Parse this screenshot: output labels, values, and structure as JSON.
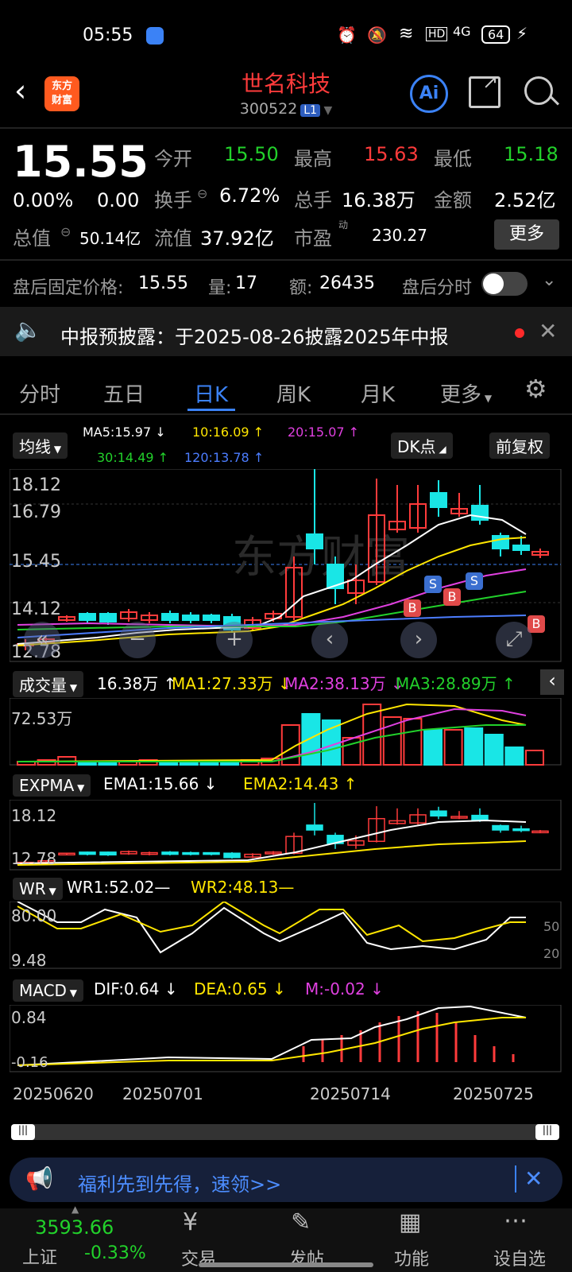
{
  "status": {
    "time": "05:55",
    "battery": "64",
    "net": "4G"
  },
  "header": {
    "name": "世名科技",
    "code": "300522",
    "level": "L1",
    "logo_top": "东方",
    "logo_bottom": "财富"
  },
  "quote": {
    "price": "15.55",
    "change_pct": "0.00%",
    "change": "0.00",
    "open_label": "今开",
    "open": "15.50",
    "high_label": "最高",
    "high": "15.63",
    "low_label": "最低",
    "low": "15.18",
    "turnover_label": "换手",
    "turnover": "6.72%",
    "volume_label": "总手",
    "volume": "16.38万",
    "amount_label": "金额",
    "amount": "2.52亿",
    "mktcap_label": "总值",
    "mktcap": "50.14亿",
    "float_label": "流值",
    "float": "37.92亿",
    "pe_label": "市盈",
    "pe_sup": "动",
    "pe": "230.27",
    "more": "更多"
  },
  "after_hours": {
    "label": "盘后固定价格:",
    "price": "15.55",
    "vol_label": "量:",
    "vol": "17",
    "amt_label": "额:",
    "amt": "26435",
    "timeshare": "盘后分时"
  },
  "notice": {
    "text": "中报预披露：于2025-08-26披露2025年中报"
  },
  "tabs": [
    "分时",
    "五日",
    "日K",
    "周K",
    "月K",
    "更多"
  ],
  "ma_bar": {
    "chip": "均线",
    "ma5": "MA5:15.97",
    "ma10": "10:16.09",
    "ma20": "20:15.07",
    "ma30": "30:14.49",
    "ma120": "120:13.78",
    "dk": "DK点",
    "adj": "前复权"
  },
  "kline": {
    "y_labels": [
      "18.12",
      "16.79",
      "15.45",
      "14.12",
      "12.78"
    ],
    "bs_labels": [
      "S",
      "S",
      "B",
      "B",
      "B"
    ]
  },
  "vol_bar": {
    "chip": "成交量",
    "v": "16.38万",
    "ma1": "MA1:27.33万",
    "ma2": "MA2:38.13万",
    "ma3": "MA3:28.89万",
    "max": "72.53万"
  },
  "expma_bar": {
    "chip": "EXPMA",
    "ema1": "EMA1:15.66",
    "ema2": "EMA2:14.43",
    "y_top": "18.12",
    "y_bottom": "12.78"
  },
  "wr_bar": {
    "chip": "WR",
    "wr1": "WR1:52.02",
    "wr2": "WR2:48.13",
    "y_top": "80.00",
    "y_bottom": "9.48",
    "r50": "50",
    "r20": "20"
  },
  "macd_bar": {
    "chip": "MACD",
    "dif": "DIF:0.64",
    "dea": "DEA:0.65",
    "m": "M:-0.02",
    "y_top": "0.84",
    "y_bottom": "-0.16"
  },
  "dates": [
    "20250620",
    "20250701",
    "20250714",
    "20250725"
  ],
  "promo": {
    "text": "福利先到先得，速领>>"
  },
  "footer": {
    "index_value": "3593.66",
    "index_name": "上证",
    "index_change": "-0.33%",
    "trade": "交易",
    "post": "发帖",
    "func": "功能",
    "watch": "设自选"
  },
  "colors": {
    "up": "#ff3b3b",
    "down": "#22d12b",
    "accent": "#3b82f6",
    "cyan": "#19e6e6",
    "yellow": "#ffe600",
    "magenta": "#e040e0"
  }
}
